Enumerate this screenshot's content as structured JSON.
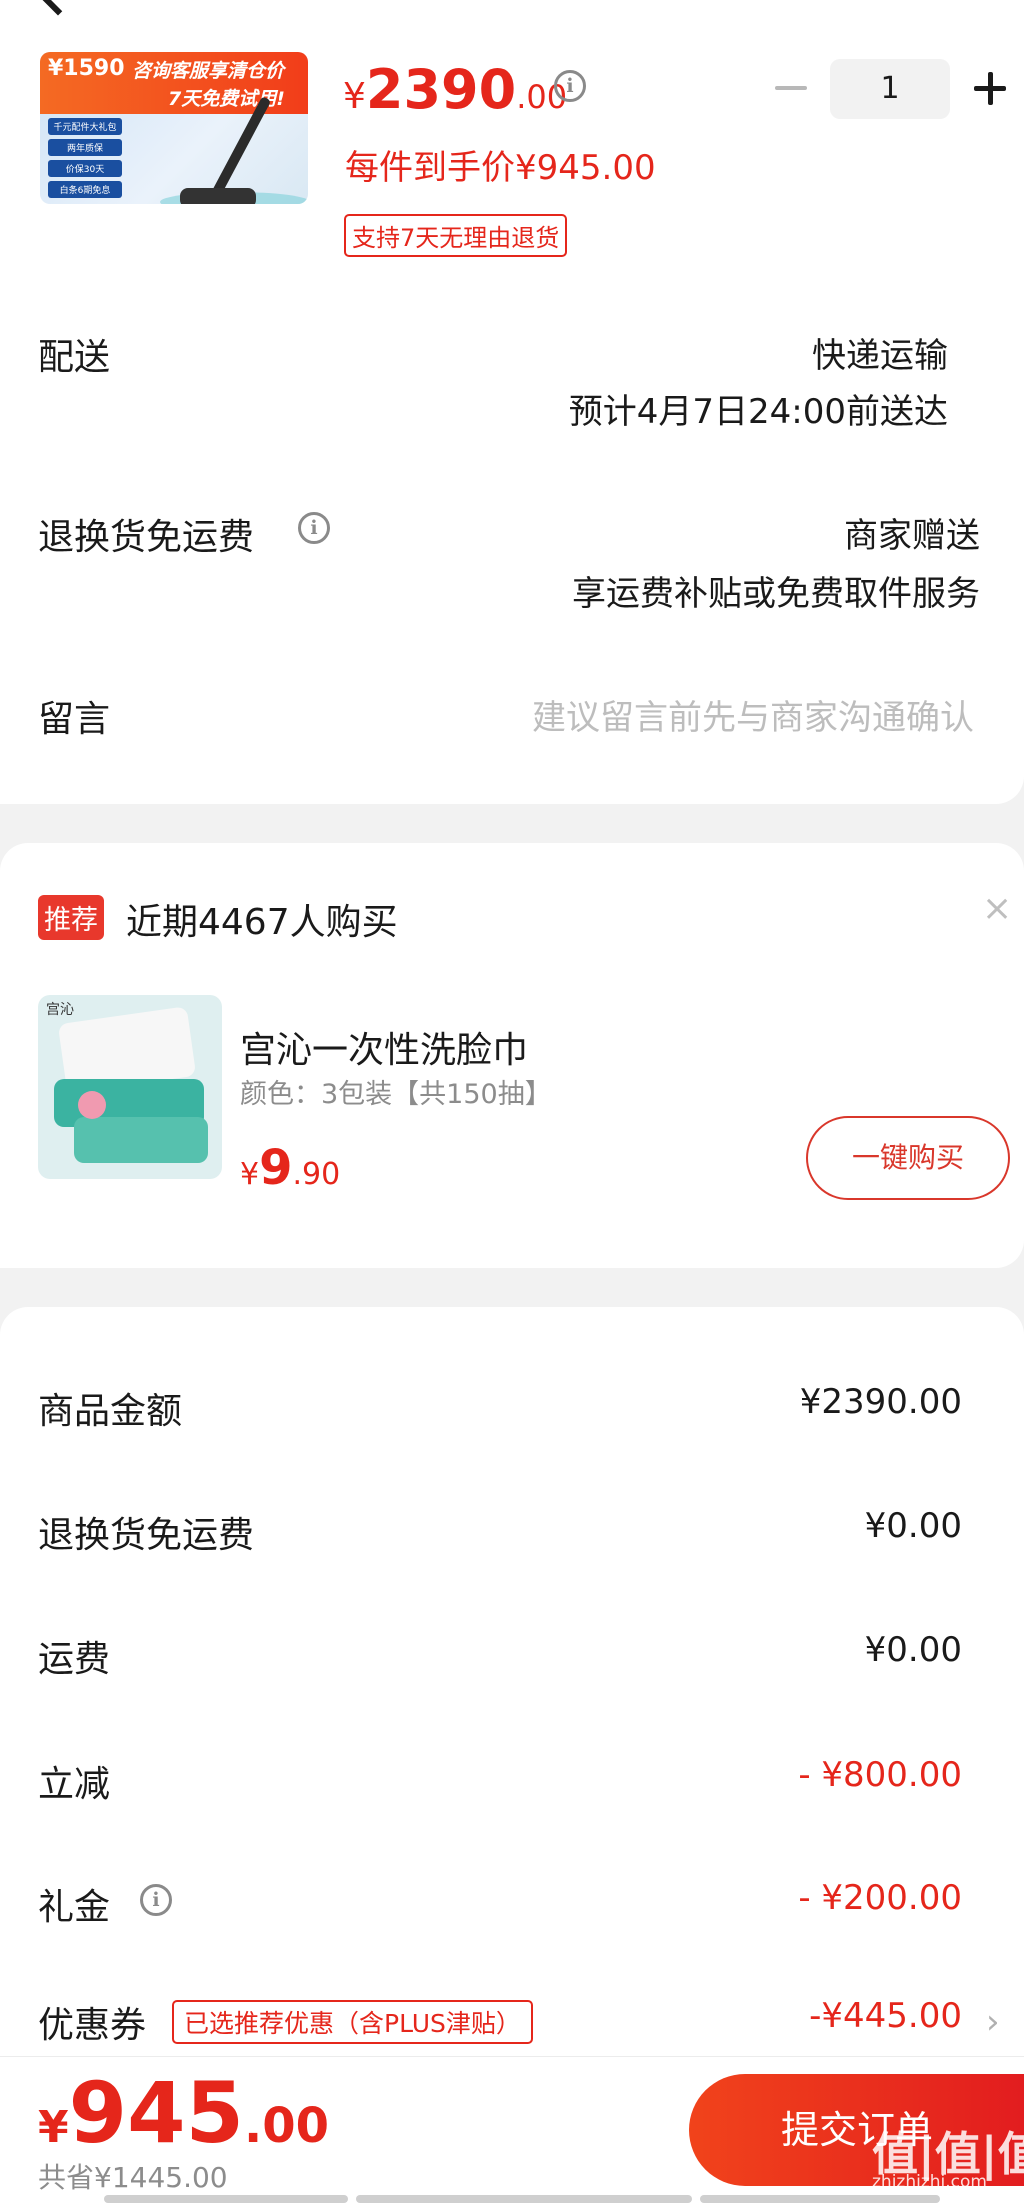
{
  "product": {
    "image": {
      "price_tag": "¥1590",
      "promo_line1": "咨询客服享清仓价",
      "promo_line2": "7天免费试用!",
      "side_labels": [
        "千元配件大礼包",
        "两年质保",
        "价保30天",
        "白条6期免息"
      ]
    },
    "price": {
      "currency": "¥",
      "integer": "2390",
      "decimal": ".00"
    },
    "unit_price": "每件到手价¥945.00",
    "return_badge": "支持7天无理由退货",
    "quantity": "1"
  },
  "delivery": {
    "label": "配送",
    "method": "快递运输",
    "estimate": "预计4月7日24:00前送达"
  },
  "return_shipping": {
    "label": "退换货免运费",
    "value": "商家赠送",
    "detail": "享运费补贴或免费取件服务"
  },
  "message": {
    "label": "留言",
    "placeholder": "建议留言前先与商家沟通确认"
  },
  "recommend": {
    "tag": "推荐",
    "title": "近期4467人购买",
    "close": "×",
    "item": {
      "brand": "宫沁",
      "name": "宫沁一次性洗脸巾",
      "spec": "颜色：3包装【共150抽】",
      "price": {
        "currency": "¥",
        "integer": "9",
        "decimal": ".90"
      },
      "buy_label": "一键购买"
    }
  },
  "summary": {
    "rows": [
      {
        "label": "商品金额",
        "value": "¥2390.00"
      },
      {
        "label": "退换货免运费",
        "value": "¥0.00"
      },
      {
        "label": "运费",
        "value": "¥0.00"
      },
      {
        "label": "立减",
        "value": "- ¥800.00"
      },
      {
        "label": "礼金",
        "value": "- ¥200.00"
      },
      {
        "label": "优惠券",
        "value": "-¥445.00"
      }
    ],
    "coupon_badge": "已选推荐优惠（含PLUS津贴）"
  },
  "bottom": {
    "total": {
      "currency": "¥",
      "integer": "945",
      "decimal": ".00"
    },
    "saved": "共省¥1445.00",
    "submit_label": "提交订单",
    "watermark": "值|值|值",
    "watermark_url": "zhizhizhi.com"
  },
  "colors": {
    "accent": "#e5261b",
    "button": "#f1431b"
  }
}
